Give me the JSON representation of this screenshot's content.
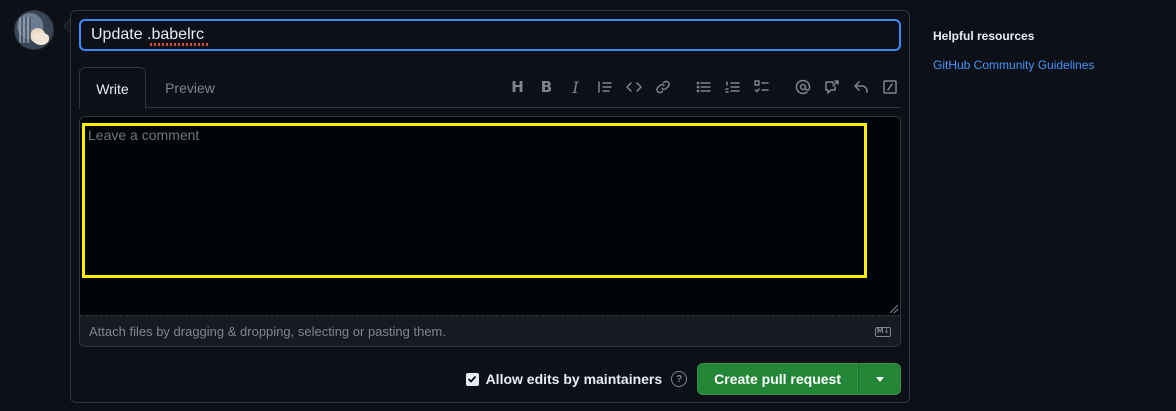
{
  "title_field": {
    "value": "Update .babelrc"
  },
  "tabs": [
    {
      "label": "Write",
      "active": true
    },
    {
      "label": "Preview",
      "active": false
    }
  ],
  "toolbar": [
    "heading-icon",
    "bold-icon",
    "italic-icon",
    "quote-icon",
    "code-icon",
    "link-icon",
    "unordered-list-icon",
    "ordered-list-icon",
    "task-list-icon",
    "mention-icon",
    "cross-reference-icon",
    "reply-icon",
    "slash-commands-icon"
  ],
  "toolbar_text": {
    "heading": "H",
    "bold": "B",
    "italic": "I"
  },
  "comment": {
    "placeholder": "Leave a comment",
    "value": ""
  },
  "attach": {
    "text": "Attach files by dragging & dropping, selecting or pasting them.",
    "md_badge": "M↓"
  },
  "footer": {
    "allow_edits_label": "Allow edits by maintainers",
    "allow_edits_checked": true,
    "help_glyph": "?",
    "create_button_label": "Create pull request"
  },
  "sidebar": {
    "heading": "Helpful resources",
    "links": [
      "GitHub Community Guidelines"
    ]
  },
  "colors": {
    "background": "#0d1117",
    "border": "#30363d",
    "accent_blue": "#388bfd",
    "link_blue": "#4493f8",
    "button_green": "#238636",
    "highlight_yellow": "#fff000"
  }
}
